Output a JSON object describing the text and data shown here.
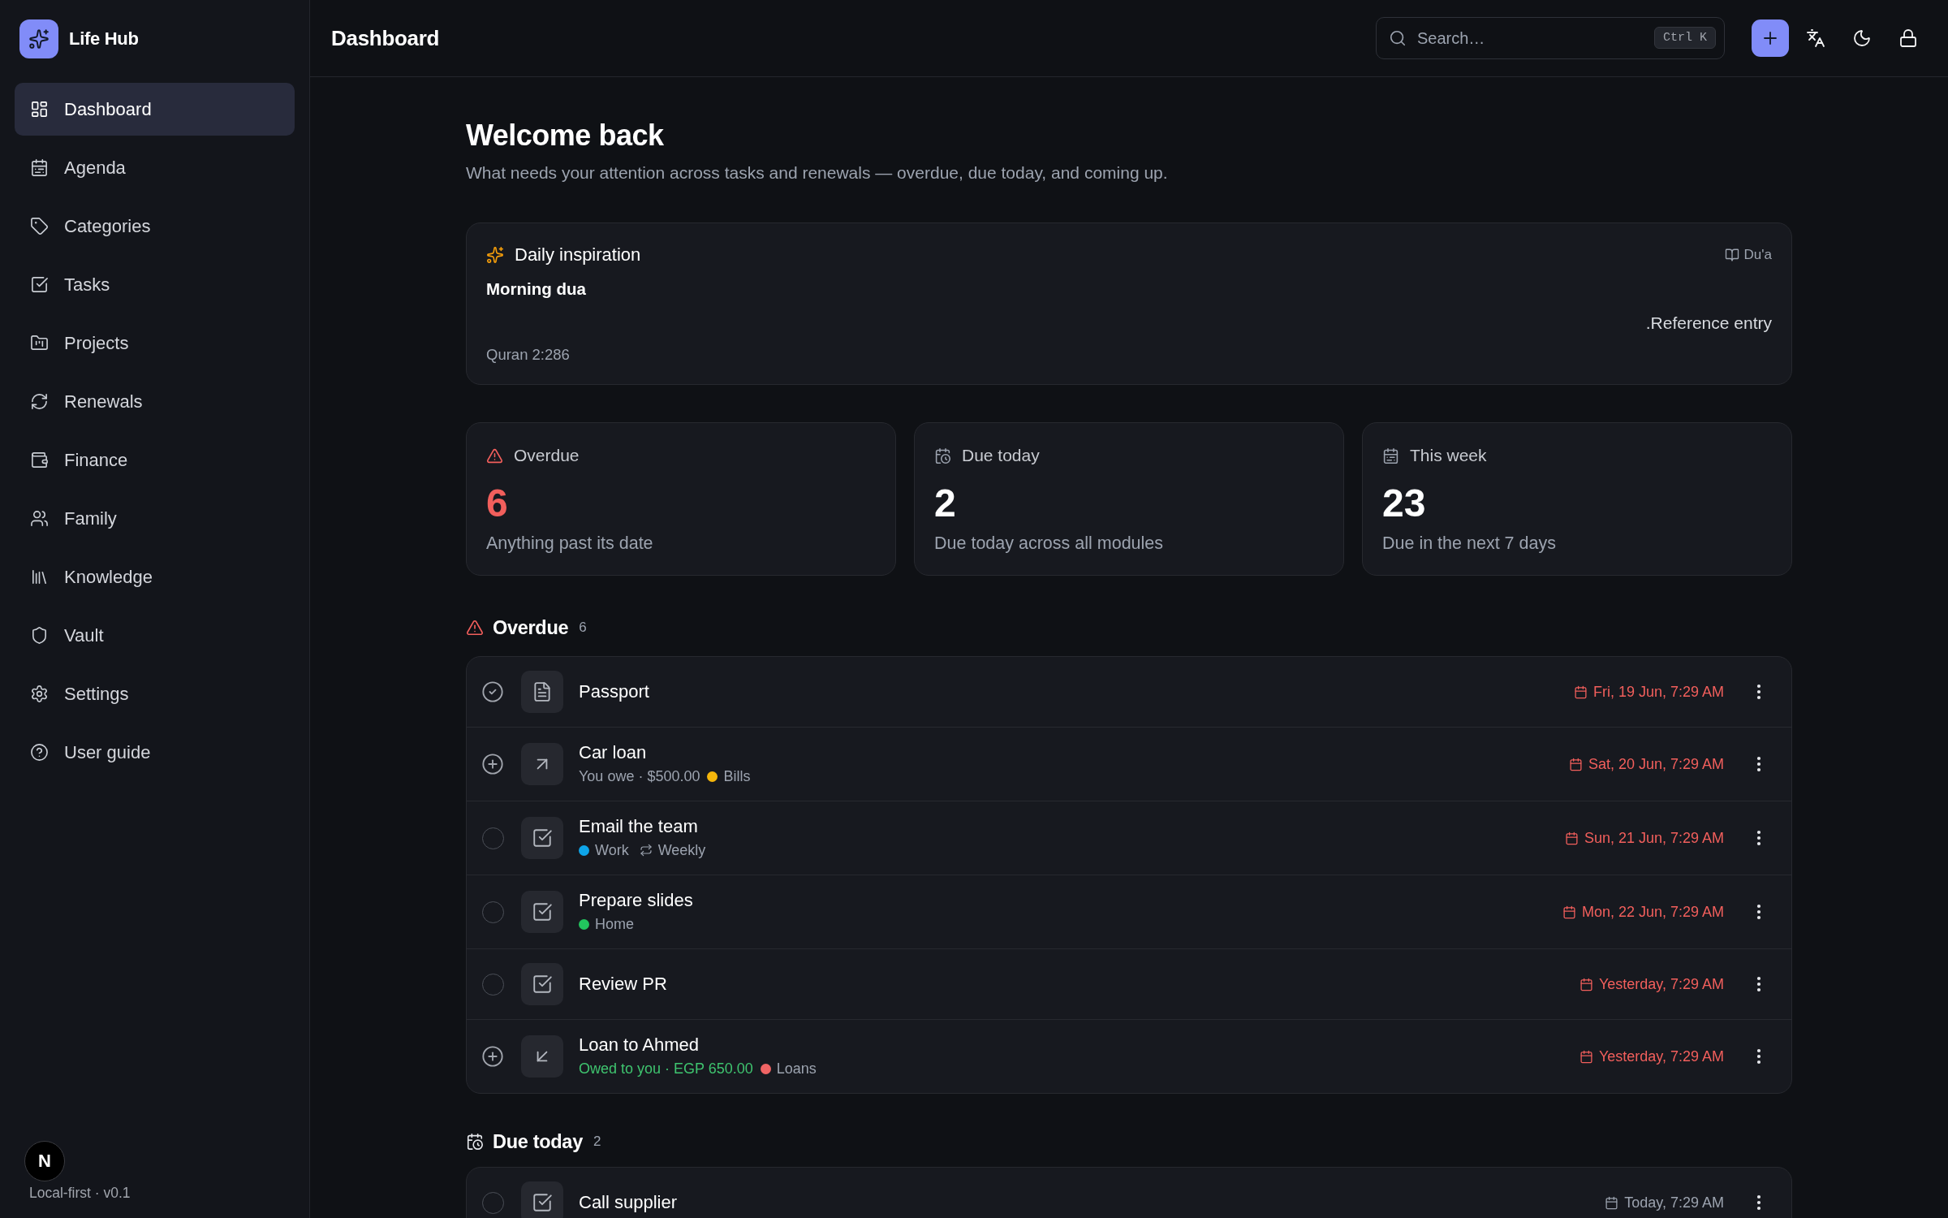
{
  "sidebar": {
    "brand": "Life Hub",
    "items": [
      {
        "label": "Dashboard",
        "selected": true
      },
      {
        "label": "Agenda",
        "selected": false
      },
      {
        "label": "Categories",
        "selected": false
      },
      {
        "label": "Tasks",
        "selected": false
      },
      {
        "label": "Projects",
        "selected": false
      },
      {
        "label": "Renewals",
        "selected": false
      },
      {
        "label": "Finance",
        "selected": false
      },
      {
        "label": "Family",
        "selected": false
      },
      {
        "label": "Knowledge",
        "selected": false
      },
      {
        "label": "Vault",
        "selected": false
      },
      {
        "label": "Settings",
        "selected": false
      },
      {
        "label": "User guide",
        "selected": false
      }
    ],
    "dev_indicator": "N",
    "footer": "Local-first · v0.1"
  },
  "header": {
    "title": "Dashboard",
    "search": {
      "placeholder": "Search…",
      "shortcut": "Ctrl K"
    }
  },
  "welcome": {
    "title": "Welcome back",
    "subtitle": "What needs your attention across tasks and renewals — overdue, due today, and coming up."
  },
  "inspiration": {
    "heading": "Daily inspiration",
    "category": "Du'a",
    "title": "Morning dua",
    "text": ".Reference entry",
    "source": "Quran 2:286"
  },
  "stats": [
    {
      "kind": "overdue",
      "label": "Overdue",
      "value": "6",
      "caption": "Anything past its date"
    },
    {
      "kind": "today",
      "label": "Due today",
      "value": "2",
      "caption": "Due today across all modules"
    },
    {
      "kind": "week",
      "label": "This week",
      "value": "23",
      "caption": "Due in the next 7 days"
    }
  ],
  "sections": [
    {
      "kind": "overdue",
      "title": "Overdue",
      "count": "6",
      "items": [
        {
          "kind": "renewal",
          "title": "Passport",
          "due": "Fri, 19 Jun, 7:29 AM"
        },
        {
          "kind": "payable",
          "title": "Car loan",
          "amount": "You owe · $500.00",
          "tag": {
            "label": "Bills",
            "color": "#f5b60b"
          },
          "due": "Sat, 20 Jun, 7:29 AM"
        },
        {
          "kind": "task",
          "checked": false,
          "title": "Email the team",
          "tag": {
            "label": "Work",
            "color": "#0ea5e9"
          },
          "repeat": "Weekly",
          "due": "Sun, 21 Jun, 7:29 AM"
        },
        {
          "kind": "task",
          "checked": false,
          "title": "Prepare slides",
          "tag": {
            "label": "Home",
            "color": "#22c55e"
          },
          "due": "Mon, 22 Jun, 7:29 AM"
        },
        {
          "kind": "task",
          "checked": false,
          "title": "Review PR",
          "due": "Yesterday, 7:29 AM"
        },
        {
          "kind": "receivable",
          "title": "Loan to Ahmed",
          "amount": "Owed to you · EGP 650.00",
          "tag": {
            "label": "Loans",
            "color": "#f06464"
          },
          "due": "Yesterday, 7:29 AM"
        }
      ]
    },
    {
      "kind": "today",
      "title": "Due today",
      "count": "2",
      "items": [
        {
          "kind": "task",
          "checked": false,
          "title": "Call supplier",
          "due": "Today, 7:29 AM"
        }
      ]
    }
  ]
}
